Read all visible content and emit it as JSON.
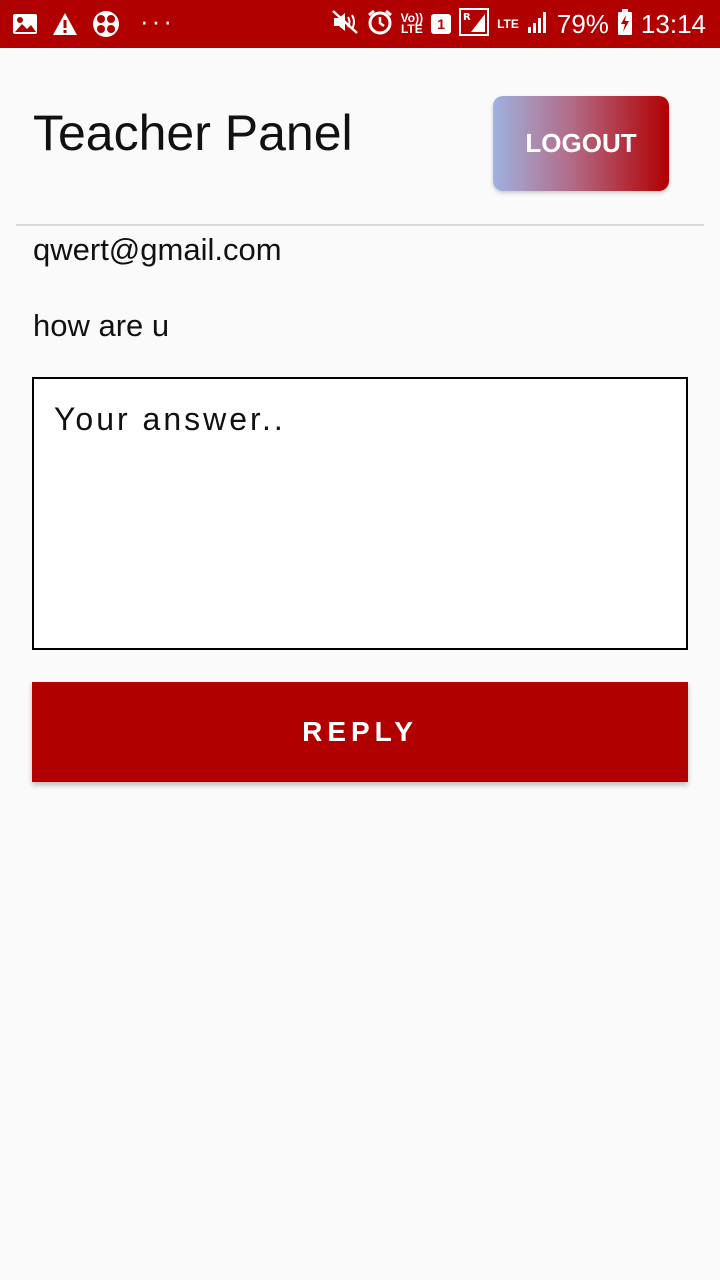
{
  "status_bar": {
    "left_icons": [
      "image-icon",
      "warning-icon",
      "app-icon"
    ],
    "overflow": "···",
    "volte": "Vo))",
    "volte_lte": "LTE",
    "sim_slot": "1",
    "roaming": "R",
    "lte": "LTE",
    "battery": "79%",
    "time": "13:14"
  },
  "header": {
    "title": "Teacher Panel",
    "logout_label": "LOGOUT"
  },
  "question": {
    "email": "qwert@gmail.com",
    "message": "how are u"
  },
  "answer": {
    "placeholder": "Your answer..",
    "value": ""
  },
  "reply": {
    "label": "REPLY"
  },
  "colors": {
    "primary": "#b00000",
    "background": "#fafafa",
    "gradient_start": "#9fb2e0",
    "gradient_end": "#b00000"
  }
}
